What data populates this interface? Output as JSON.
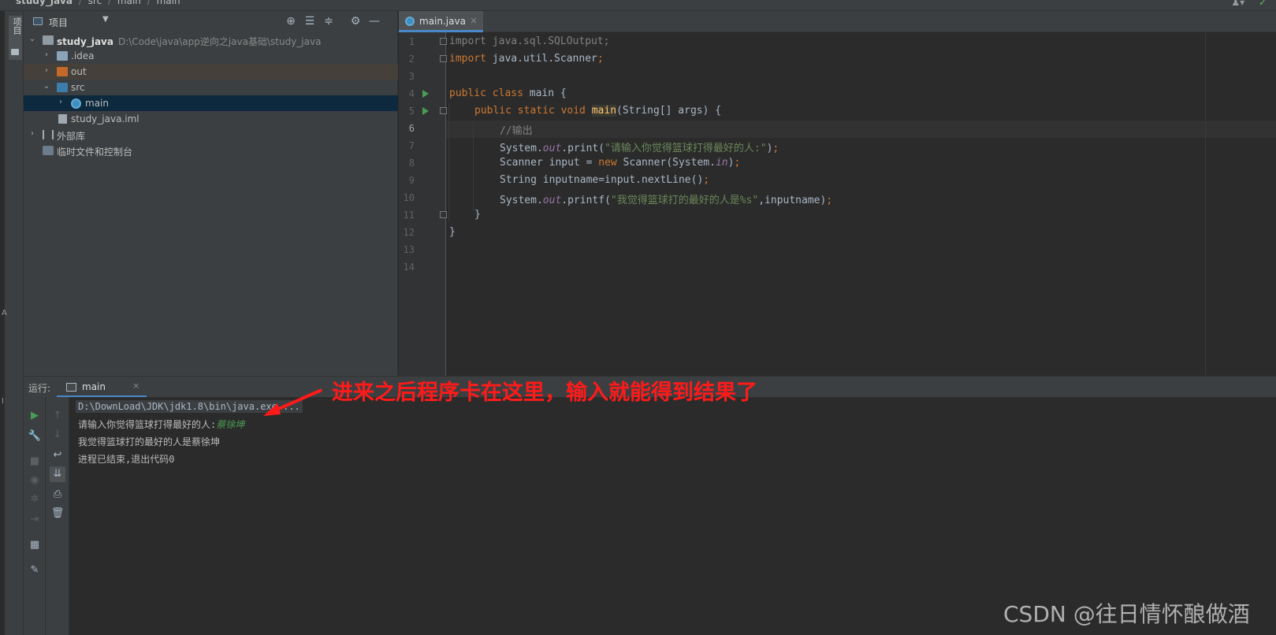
{
  "breadcrumb": {
    "items": [
      "study_java",
      "src",
      "main",
      "main"
    ],
    "separator": "/"
  },
  "left_strip": {
    "tab_label": "项目"
  },
  "project_panel": {
    "title": "项目",
    "tree": [
      {
        "label": "study_java",
        "path": "D:\\Code\\java\\app逆向之java基础\\study_java",
        "depth": 0,
        "expanded": true,
        "icon": "module-folder-icon"
      },
      {
        "label": ".idea",
        "depth": 1,
        "expanded": false,
        "icon": "folder-icon"
      },
      {
        "label": "out",
        "depth": 1,
        "expanded": false,
        "icon": "excluded-folder-icon"
      },
      {
        "label": "src",
        "depth": 1,
        "expanded": true,
        "icon": "source-folder-icon"
      },
      {
        "label": "main",
        "depth": 2,
        "expanded": false,
        "icon": "java-class-icon",
        "selected": true
      },
      {
        "label": "study_java.iml",
        "depth": 1,
        "icon": "iml-file-icon"
      },
      {
        "label": "外部库",
        "depth": 0,
        "expanded": false,
        "icon": "library-icon"
      },
      {
        "label": "临时文件和控制台",
        "depth": 0,
        "icon": "scratches-icon"
      }
    ]
  },
  "editor": {
    "tab_label": "main.java",
    "current_line": 6,
    "lines": [
      {
        "n": "1",
        "text": "import java.sql.SQLOutput;"
      },
      {
        "n": "2",
        "text": "import java.util.Scanner;"
      },
      {
        "n": "3",
        "text": ""
      },
      {
        "n": "4",
        "text": "public class main {"
      },
      {
        "n": "5",
        "text": "    public static void main(String[] args) {"
      },
      {
        "n": "6",
        "text": "        //输出"
      },
      {
        "n": "7",
        "text": "        System.out.print(\"请输入你觉得篮球打得最好的人:\");"
      },
      {
        "n": "8",
        "text": "        Scanner input = new Scanner(System.in);"
      },
      {
        "n": "9",
        "text": "        String inputname=input.nextLine();"
      },
      {
        "n": "10",
        "text": "        System.out.printf(\"我觉得篮球打的最好的人是%s\",inputname);"
      },
      {
        "n": "11",
        "text": "    }"
      },
      {
        "n": "12",
        "text": "}"
      },
      {
        "n": "13",
        "text": ""
      },
      {
        "n": "14",
        "text": ""
      }
    ],
    "tokens": {
      "l1_kw": "import",
      "l1_rest": " java.sql.SQLOutput;",
      "l2_kw": "import",
      "l2_rest": " java.util.Scanner",
      "l2_semi": ";",
      "l4_kw": "public class",
      "l4_rest": " main {",
      "l5_kw1": "public static void",
      "l5_fn": "main",
      "l5_rest": "(String[] args) {",
      "l6_cmt": "//输出",
      "l7_a": "System.",
      "l7_out": "out",
      "l7_b": ".print(",
      "l7_str": "\"请输入你觉得篮球打得最好的人:\"",
      "l7_c": ")",
      "l7_semi": ";",
      "l8_a": "Scanner input = ",
      "l8_kw": "new",
      "l8_b": " Scanner(System.",
      "l8_in": "in",
      "l8_c": ")",
      "l8_semi": ";",
      "l9_a": "String inputname=input.nextLine()",
      "l9_semi": ";",
      "l10_a": "System.",
      "l10_out": "out",
      "l10_b": ".printf(",
      "l10_str": "\"我觉得篮球打的最好的人是%s\"",
      "l10_c": ",inputname)",
      "l10_semi": ";",
      "l11": "}",
      "l12": "}"
    }
  },
  "run_panel": {
    "label": "运行:",
    "tab_label": "main",
    "console": {
      "command": "D:\\DownLoad\\JDK\\jdk1.8\\bin\\java.exe ...",
      "prompt": "请输入你觉得篮球打得最好的人:",
      "user_input": "蔡徐坤",
      "output": "我觉得篮球打的最好的人是蔡徐坤",
      "exit": "进程已结束,退出代码0"
    }
  },
  "annotation": {
    "text": "进来之后程序卡在这里，输入就能得到结果了",
    "color": "#ff1a1a"
  },
  "watermark": "CSDN @往日情怀酿做酒",
  "colors": {
    "keyword": "#cc7832",
    "string": "#6a8759",
    "static_field": "#9876aa",
    "method_decl": "#ffc66d",
    "selection": "#0d293e",
    "accent": "#4a88c7"
  }
}
